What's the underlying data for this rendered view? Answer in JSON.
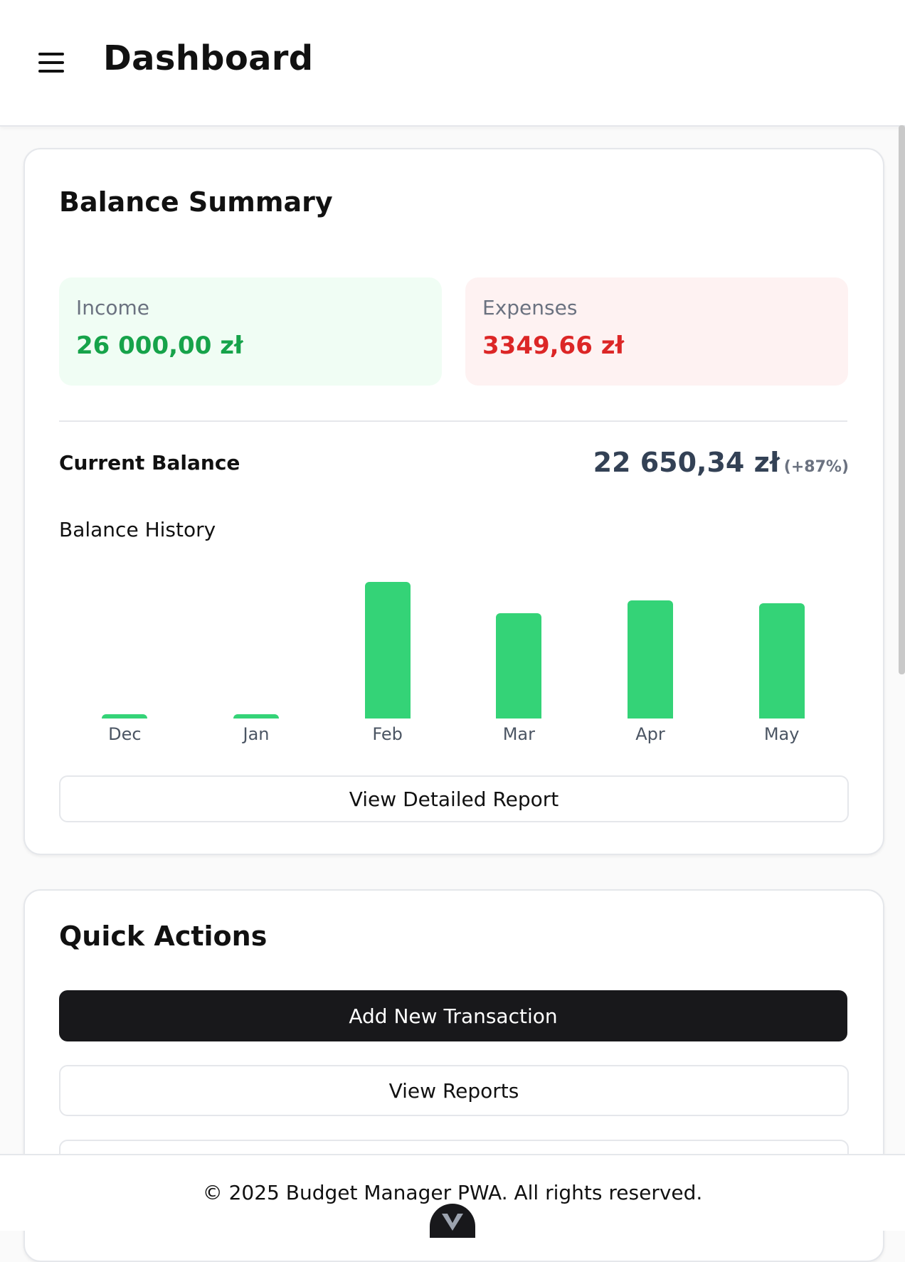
{
  "header": {
    "title": "Dashboard",
    "menu_icon": "hamburger-menu-icon"
  },
  "balance_summary": {
    "title": "Balance Summary",
    "income": {
      "label": "Income",
      "value": "26 000,00 zł",
      "color": "#16a34a",
      "bg": "#f0fdf4"
    },
    "expenses": {
      "label": "Expenses",
      "value": "3349,66 zł",
      "color": "#dc2626",
      "bg": "#fef2f2"
    },
    "current_balance": {
      "label": "Current Balance",
      "value": "22 650,34 zł",
      "change": "(+87%)"
    },
    "history_label": "Balance History",
    "detail_button": "View Detailed Report"
  },
  "chart_data": {
    "type": "bar",
    "categories": [
      "Dec",
      "Jan",
      "Feb",
      "Mar",
      "Apr",
      "May"
    ],
    "values": [
      800,
      800,
      35000,
      27000,
      30200,
      29500
    ],
    "ylim": [
      0,
      35000
    ],
    "grid": false,
    "bar_color": "#34d377"
  },
  "quick_actions": {
    "title": "Quick Actions",
    "add_transaction": "Add New Transaction",
    "view_reports": "View Reports",
    "third_button": ""
  },
  "footer": {
    "text": "© 2025 Budget Manager PWA. All rights reserved."
  },
  "colors": {
    "primary_dark": "#18181b",
    "accent_green": "#34d377",
    "muted": "#6b7280"
  }
}
